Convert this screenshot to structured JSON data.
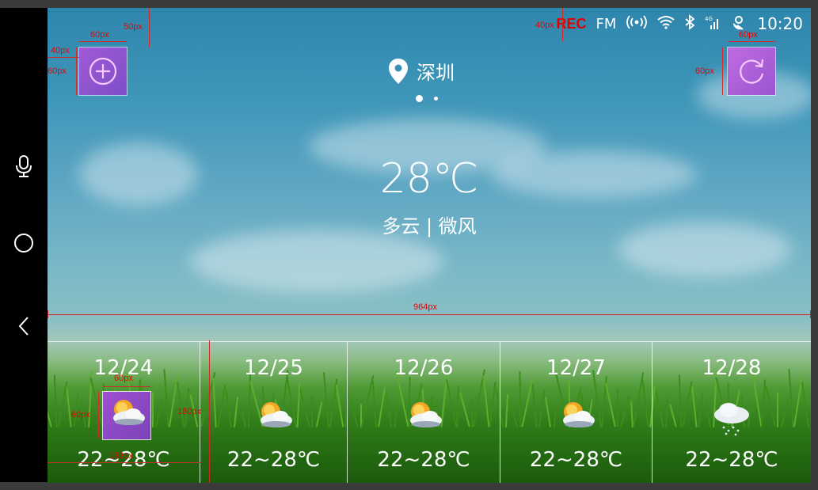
{
  "statusbar": {
    "rec": "REC",
    "fm": "FM",
    "time": "10:20",
    "icons": [
      "radio-signal-icon",
      "wifi-icon",
      "bluetooth-icon",
      "cellular-4g-icon",
      "satellite-icon"
    ]
  },
  "nav": {
    "icons": [
      "microphone-icon",
      "home-circle-icon",
      "back-chevron-icon"
    ]
  },
  "location": {
    "city": "深圳",
    "icon": "location-pin-icon"
  },
  "pager": {
    "pages": 2,
    "active": 1
  },
  "weather": {
    "temperature": "28℃",
    "condition": "多云 | 微风"
  },
  "forecast": [
    {
      "date": "12/24",
      "range": "22~28℃",
      "icon": "sun-behind-cloud-icon"
    },
    {
      "date": "12/25",
      "range": "22~28℃",
      "icon": "sun-behind-cloud-icon"
    },
    {
      "date": "12/26",
      "range": "22~28℃",
      "icon": "sun-behind-cloud-icon"
    },
    {
      "date": "12/27",
      "range": "22~28℃",
      "icon": "sun-behind-cloud-icon"
    },
    {
      "date": "12/28",
      "range": "22~28℃",
      "icon": "rain-cloud-icon"
    }
  ],
  "annotations": {
    "a1": "60px",
    "a2": "50px",
    "a3": "40px",
    "a4": "60px",
    "a5": "40px",
    "a6": "60px",
    "a7": "60px",
    "a8": "964px",
    "a9": "60px",
    "a10": "60px",
    "a11": "180px",
    "a12": "193px"
  },
  "colors": {
    "accent_button": "#8e55cf",
    "rec": "#e00000",
    "annotation": "#d02a2a"
  }
}
